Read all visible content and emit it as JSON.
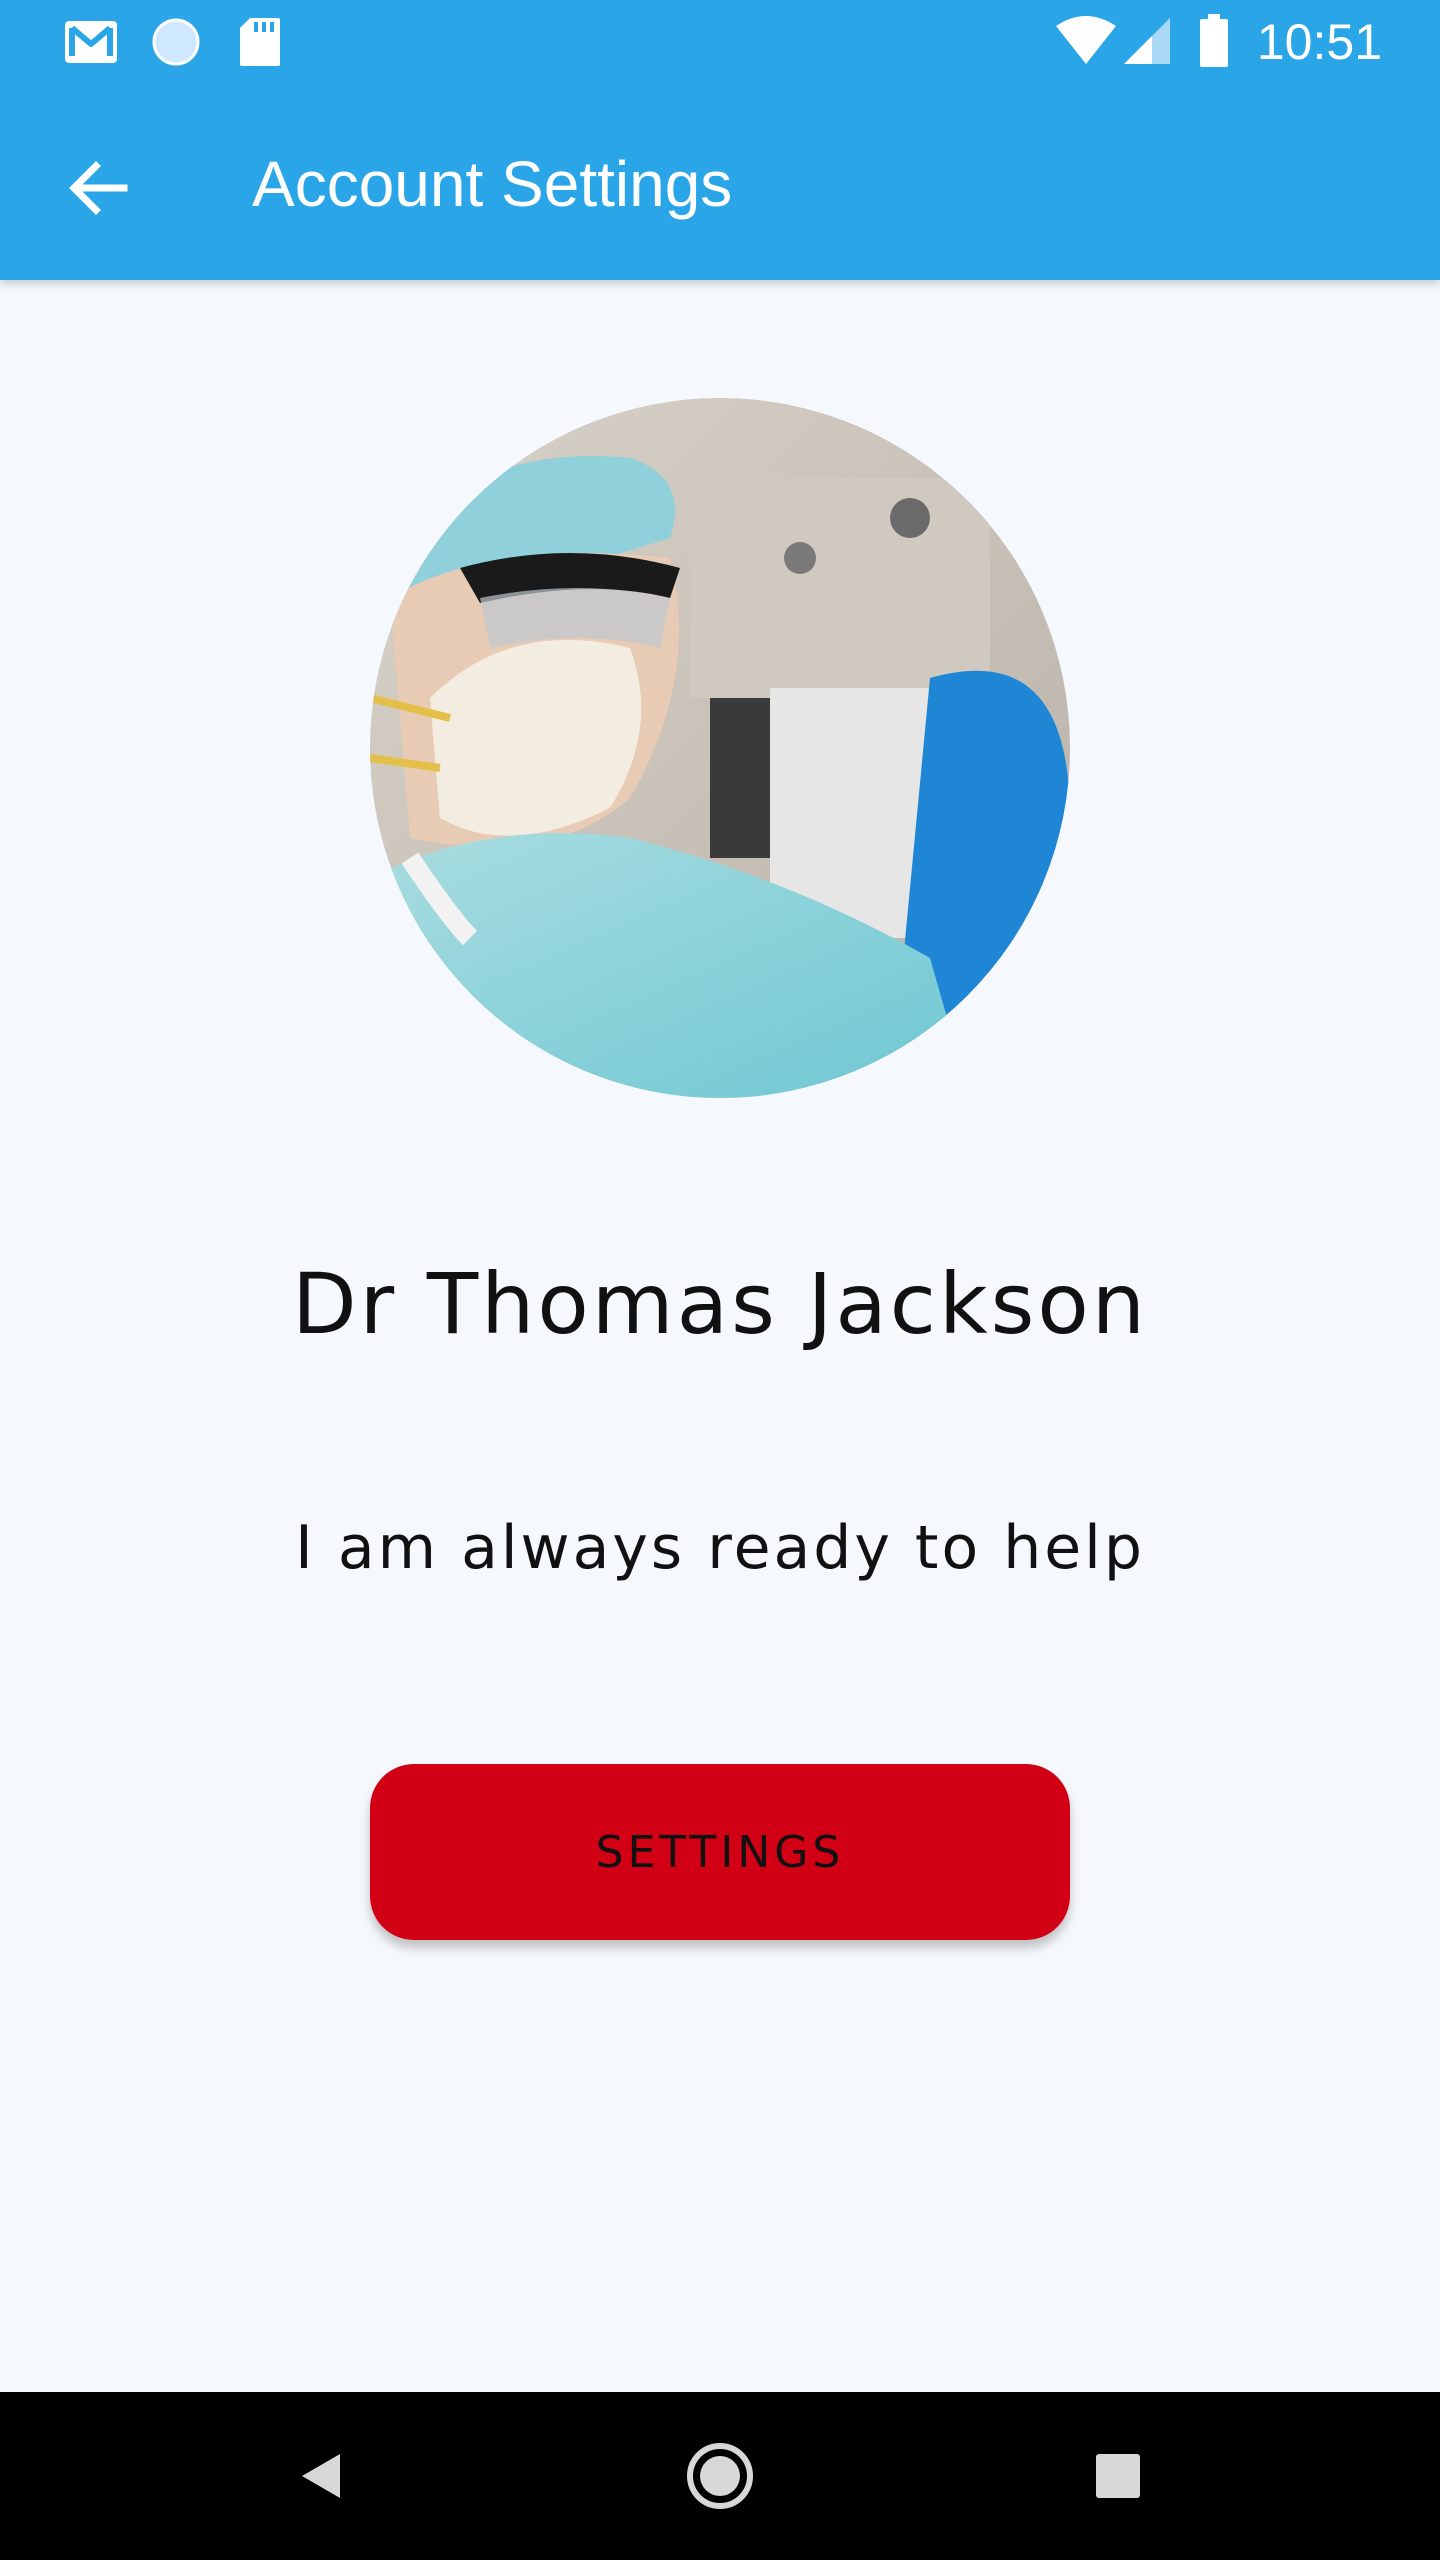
{
  "status_bar": {
    "time": "10:51",
    "icons": [
      "gmail-icon",
      "circle-notification-icon",
      "sd-card-icon",
      "wifi-icon",
      "signal-icon",
      "battery-icon"
    ]
  },
  "app_bar": {
    "title": "Account Settings",
    "back_icon": "arrow-back-icon"
  },
  "profile": {
    "name": "Dr Thomas Jackson",
    "status": "I am always ready to help",
    "avatar": "doctor-photo"
  },
  "actions": {
    "settings_label": "SETTINGS"
  },
  "nav_bar": {
    "icons": [
      "back-triangle-icon",
      "home-circle-icon",
      "recents-square-icon"
    ]
  },
  "colors": {
    "primary": "#2aa6e8",
    "accent": "#d10014",
    "background": "#f5f8fc",
    "nav": "#000000"
  }
}
